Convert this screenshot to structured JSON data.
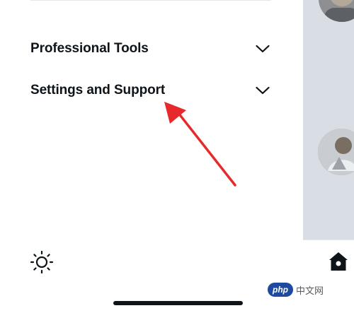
{
  "menu": {
    "items": [
      {
        "label": "Professional Tools",
        "icon": "chevron-down-icon",
        "expanded": false
      },
      {
        "label": "Settings and Support",
        "icon": "chevron-down-icon",
        "expanded": false
      }
    ]
  },
  "display_icon": "sun-icon",
  "bottom_nav": {
    "icon": "home-icon"
  },
  "annotation": {
    "type": "arrow",
    "color": "#e8292b",
    "target": "Settings and Support"
  },
  "watermark": {
    "logo": "php",
    "text": "中文网"
  },
  "colors": {
    "text_primary": "#0f1419",
    "divider": "#e5e8ea",
    "overlay": "#d8dee3",
    "arrow": "#e8292b"
  }
}
